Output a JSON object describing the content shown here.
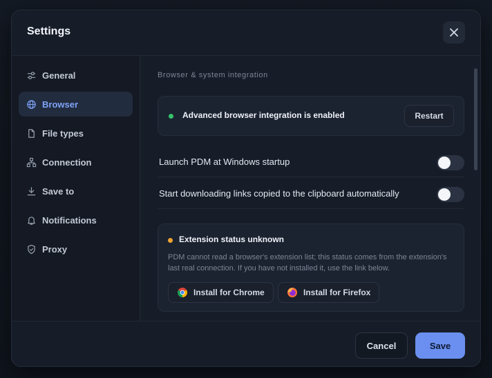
{
  "dialog": {
    "title": "Settings"
  },
  "sidebar": {
    "items": [
      {
        "label": "General",
        "icon": "sliders-icon",
        "active": false
      },
      {
        "label": "Browser",
        "icon": "globe-icon",
        "active": true
      },
      {
        "label": "File types",
        "icon": "file-icon",
        "active": false
      },
      {
        "label": "Connection",
        "icon": "network-icon",
        "active": false
      },
      {
        "label": "Save to",
        "icon": "download-icon",
        "active": false
      },
      {
        "label": "Notifications",
        "icon": "bell-icon",
        "active": false
      },
      {
        "label": "Proxy",
        "icon": "shield-icon",
        "active": false
      }
    ]
  },
  "content": {
    "section_label": "Browser & system integration",
    "integration": {
      "status_text": "Advanced browser integration is enabled",
      "status_color": "#34c46b",
      "restart_label": "Restart"
    },
    "toggles": [
      {
        "label": "Launch PDM at Windows startup",
        "on": false
      },
      {
        "label": "Start downloading links copied to the clipboard automatically",
        "on": false
      }
    ],
    "extension": {
      "title": "Extension status unknown",
      "status_color": "#f0a430",
      "description": "PDM cannot read a browser's extension list; this status comes from the extension's last real connection. If you have not installed it, use the link below.",
      "chrome_label": "Install for Chrome",
      "firefox_label": "Install for Firefox"
    }
  },
  "footer": {
    "cancel_label": "Cancel",
    "save_label": "Save"
  },
  "colors": {
    "accent": "#6a8ff0",
    "active_nav_text": "#7ea2f5"
  }
}
